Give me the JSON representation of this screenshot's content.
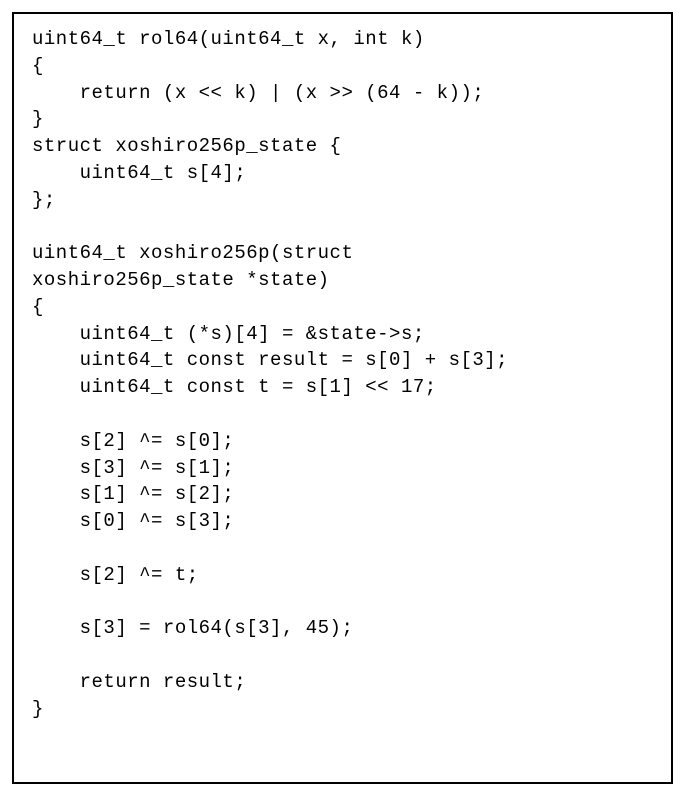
{
  "code": {
    "lines": [
      "uint64_t rol64(uint64_t x, int k)",
      "{",
      "    return (x << k) | (x >> (64 - k));",
      "}",
      "struct xoshiro256p_state {",
      "    uint64_t s[4];",
      "};",
      "",
      "uint64_t xoshiro256p(struct",
      "xoshiro256p_state *state)",
      "{",
      "    uint64_t (*s)[4] = &state->s;",
      "    uint64_t const result = s[0] + s[3];",
      "    uint64_t const t = s[1] << 17;",
      "",
      "    s[2] ^= s[0];",
      "    s[3] ^= s[1];",
      "    s[1] ^= s[2];",
      "    s[0] ^= s[3];",
      "",
      "    s[2] ^= t;",
      "",
      "    s[3] = rol64(s[3], 45);",
      "",
      "    return result;",
      "}"
    ]
  }
}
